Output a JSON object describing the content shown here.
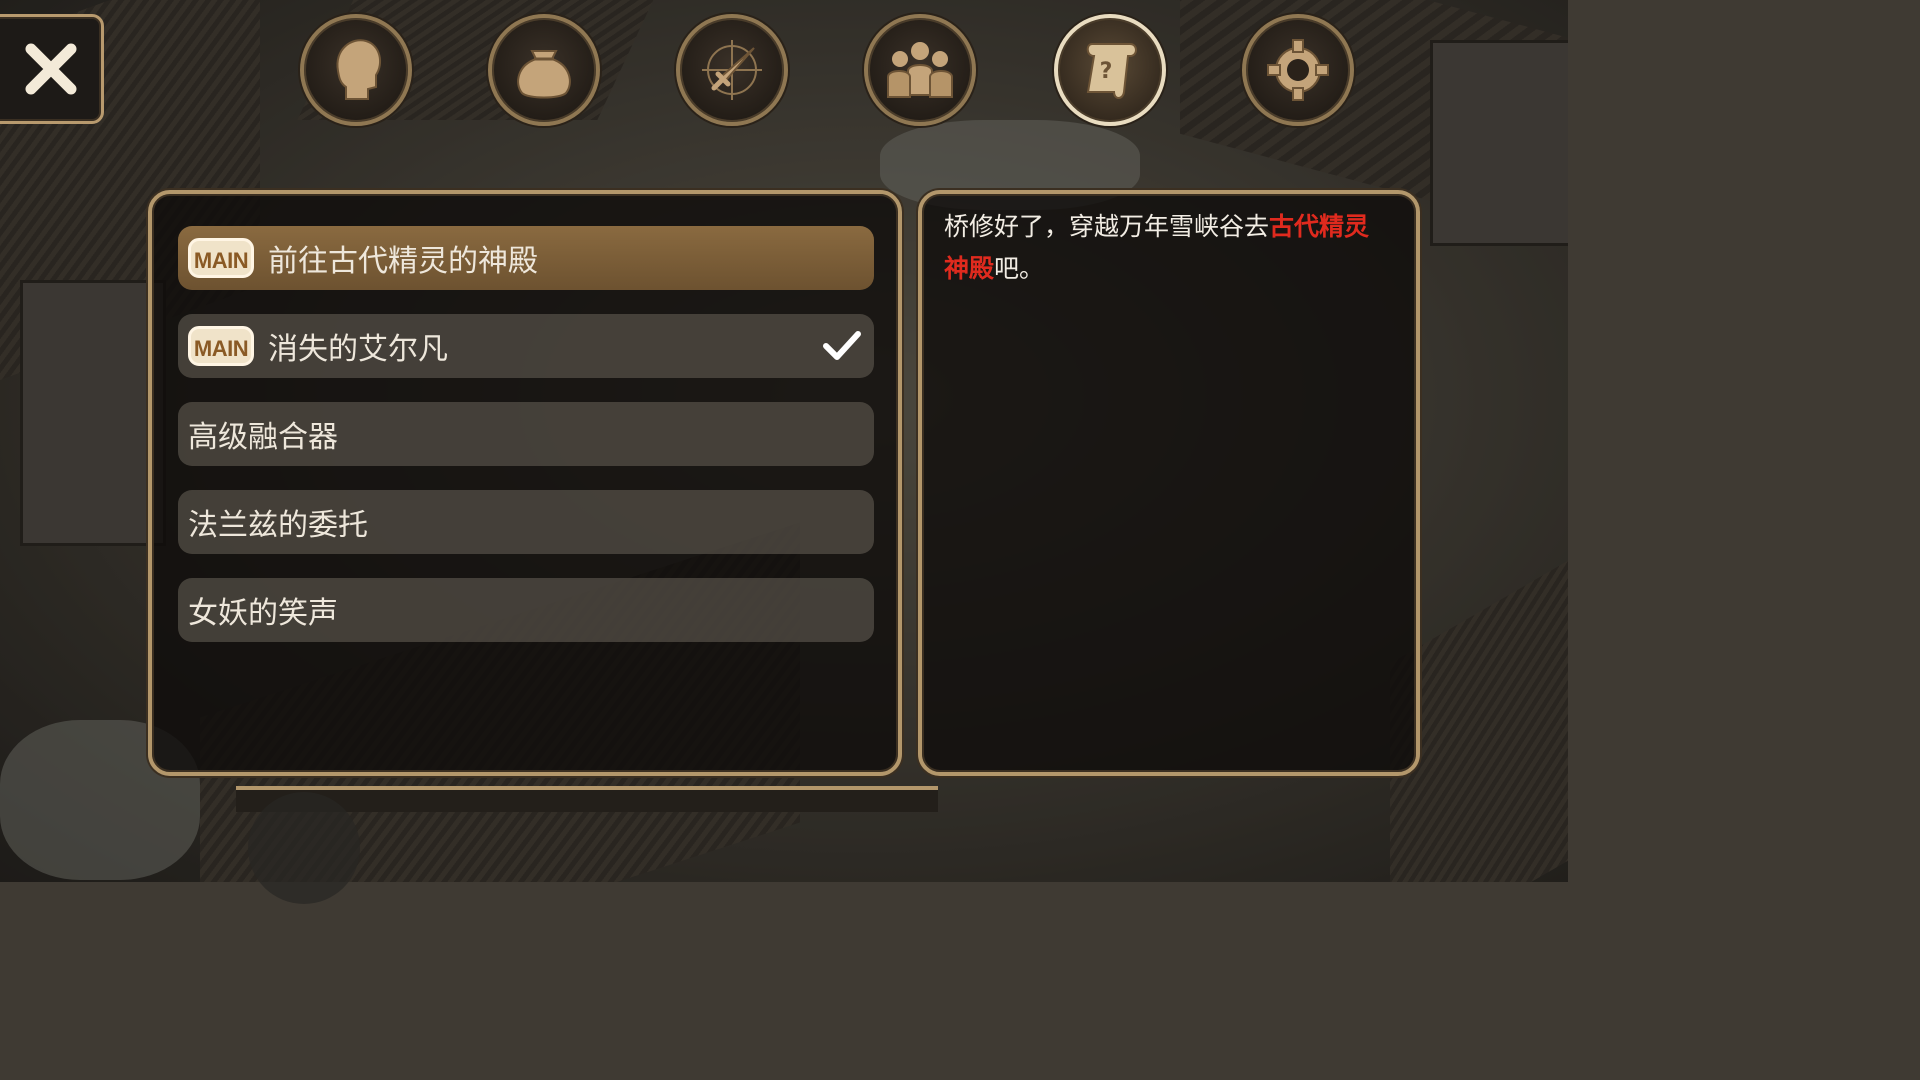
{
  "close_button": {
    "icon": "close-icon"
  },
  "top_menu": [
    {
      "id": "character",
      "icon": "head-silhouette-icon",
      "active": false
    },
    {
      "id": "inventory",
      "icon": "bag-icon",
      "active": false
    },
    {
      "id": "skills",
      "icon": "sword-compass-icon",
      "active": false
    },
    {
      "id": "party",
      "icon": "group-icon",
      "active": false
    },
    {
      "id": "quests",
      "icon": "quest-scroll-icon",
      "active": true
    },
    {
      "id": "settings",
      "icon": "gear-icon",
      "active": false
    }
  ],
  "quest_list": {
    "items": [
      {
        "tag": "MAIN",
        "label": "前往古代精灵的神殿",
        "selected": true,
        "completed": false
      },
      {
        "tag": "MAIN",
        "label": "消失的艾尔凡",
        "selected": false,
        "completed": true
      },
      {
        "tag": "",
        "label": "高级融合器",
        "selected": false,
        "completed": false
      },
      {
        "tag": "",
        "label": "法兰兹的委托",
        "selected": false,
        "completed": false
      },
      {
        "tag": "",
        "label": "女妖的笑声",
        "selected": false,
        "completed": false
      }
    ]
  },
  "description": {
    "text_before": "桥修好了，穿越万年雪峡谷去",
    "highlight": "古代精灵神殿",
    "text_after": "吧。",
    "highlight_color": "#e02a1e"
  },
  "colors": {
    "frame": "#b3976b",
    "selected_item": "#7b5d36",
    "tag_text": "#8a5a25"
  }
}
